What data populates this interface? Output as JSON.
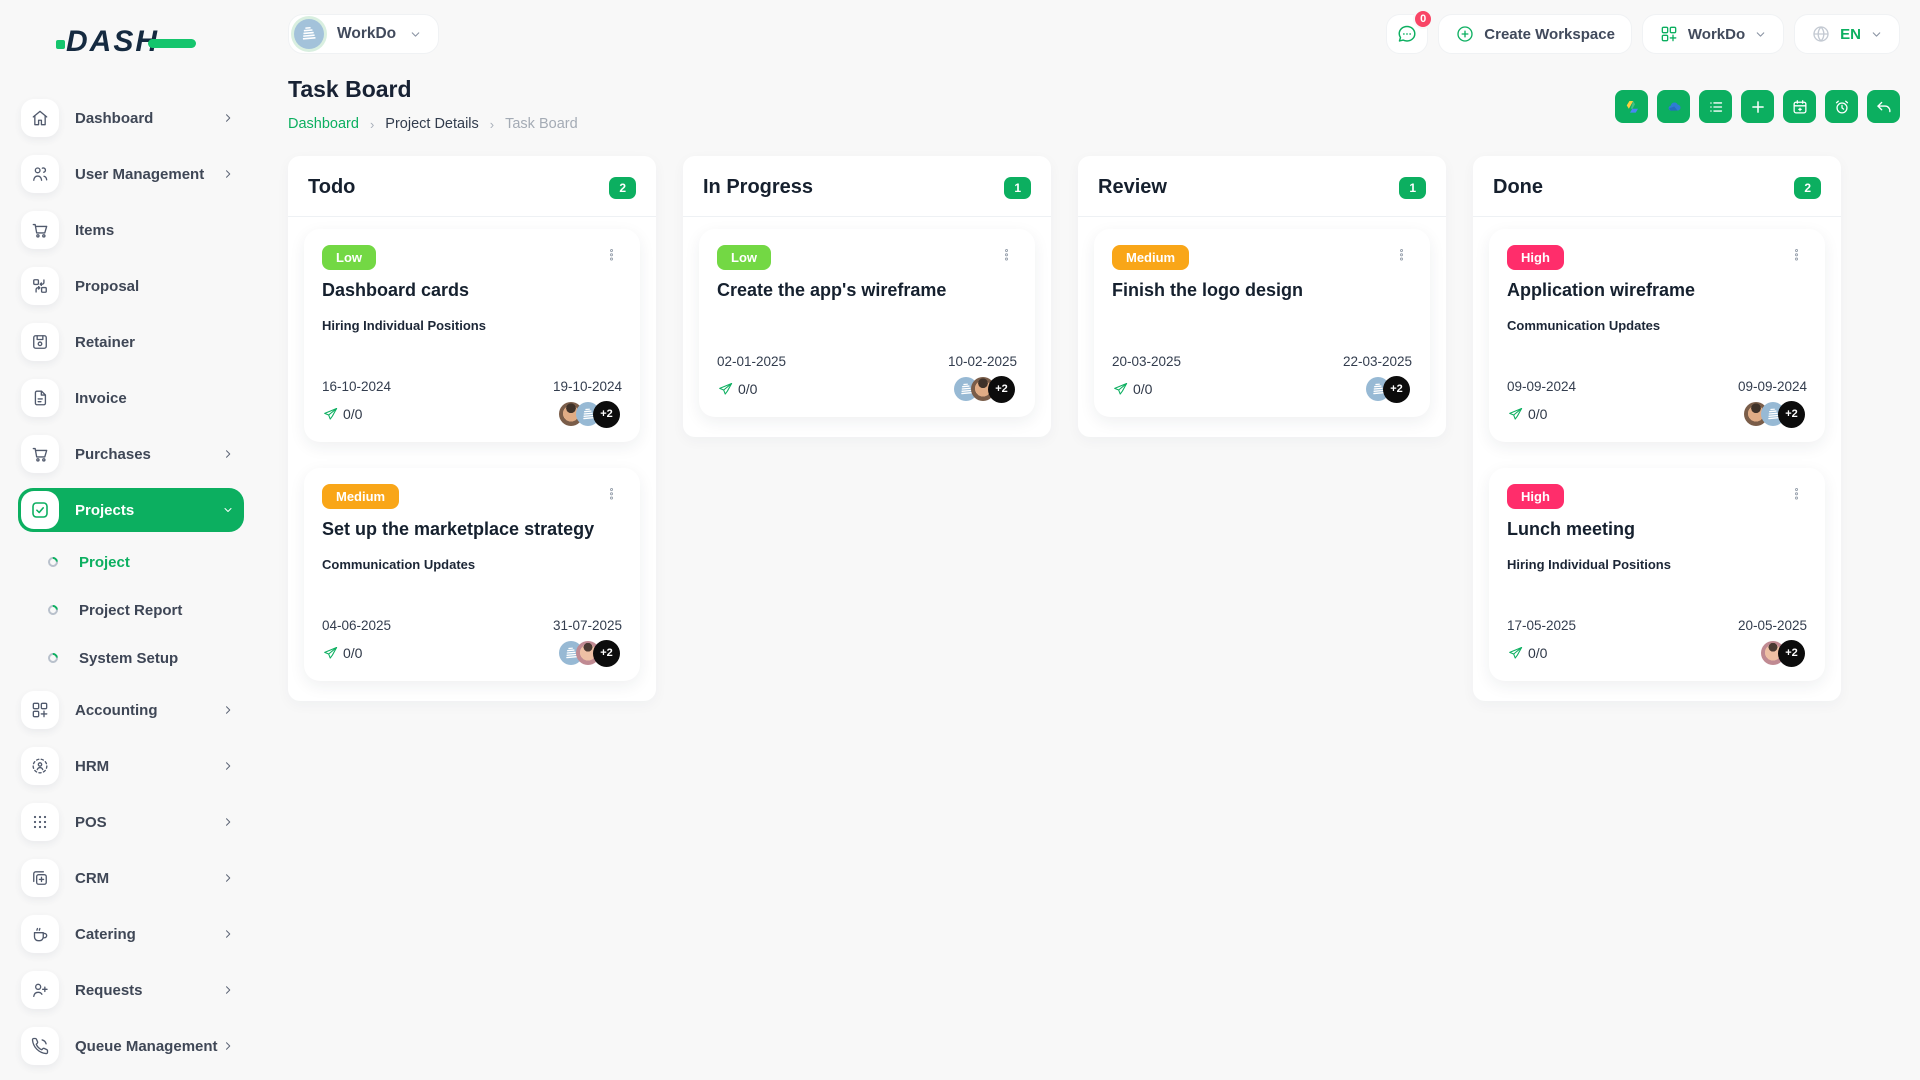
{
  "app": {
    "logo_text": "DASH"
  },
  "colors": {
    "primary": "#0CAF60",
    "priority_low": "#73d844",
    "priority_medium": "#f9a618",
    "priority_high": "#ff2d6b",
    "notification_badge": "#f94566",
    "workdo_avatar_bg": "#97b9d4"
  },
  "sidebar": {
    "items": [
      {
        "label": "Dashboard",
        "icon": "home",
        "chevron": "right"
      },
      {
        "label": "User Management",
        "icon": "users",
        "chevron": "right"
      },
      {
        "label": "Items",
        "icon": "cart",
        "chevron": ""
      },
      {
        "label": "Proposal",
        "icon": "proposal",
        "chevron": ""
      },
      {
        "label": "Retainer",
        "icon": "retainer",
        "chevron": ""
      },
      {
        "label": "Invoice",
        "icon": "invoice",
        "chevron": ""
      },
      {
        "label": "Purchases",
        "icon": "cart",
        "chevron": "right"
      },
      {
        "label": "Projects",
        "icon": "check-square",
        "chevron": "down",
        "active": true,
        "children": [
          {
            "label": "Project",
            "active": true
          },
          {
            "label": "Project Report",
            "active": false
          },
          {
            "label": "System Setup",
            "active": false
          }
        ]
      },
      {
        "label": "Accounting",
        "icon": "grid-plus",
        "chevron": "right"
      },
      {
        "label": "HRM",
        "icon": "hrm",
        "chevron": "right"
      },
      {
        "label": "POS",
        "icon": "dots-grid",
        "chevron": "right"
      },
      {
        "label": "CRM",
        "icon": "crm",
        "chevron": "right"
      },
      {
        "label": "Catering",
        "icon": "coffee",
        "chevron": "right"
      },
      {
        "label": "Requests",
        "icon": "user-plus",
        "chevron": "right"
      },
      {
        "label": "Queue Management",
        "icon": "phone",
        "chevron": "right"
      }
    ]
  },
  "header": {
    "workspace_name": "WorkDo",
    "messages_badge": "0",
    "create_workspace_label": "Create Workspace",
    "app_switcher_label": "WorkDo",
    "language": "EN"
  },
  "page": {
    "title": "Task Board",
    "breadcrumb": [
      {
        "label": "Dashboard"
      },
      {
        "label": "Project Details"
      },
      {
        "label": "Task Board"
      }
    ],
    "breadcrumb_separator": "›",
    "toolbar": [
      {
        "icon": "gdrive",
        "name": "google-drive"
      },
      {
        "icon": "onedrive",
        "name": "onedrive"
      },
      {
        "icon": "list",
        "name": "task-list"
      },
      {
        "icon": "plus",
        "name": "add-task"
      },
      {
        "icon": "calendar",
        "name": "calendar"
      },
      {
        "icon": "alarm",
        "name": "reminder"
      },
      {
        "icon": "undo",
        "name": "back"
      }
    ]
  },
  "board": {
    "columns": [
      {
        "title": "Todo",
        "count": "2",
        "cards": [
          {
            "priority": "Low",
            "title": "Dashboard cards",
            "milestone": "Hiring Individual Positions",
            "start": "16-10-2024",
            "end": "19-10-2024",
            "progress": "0/0",
            "avatars": [
              "photo-1",
              "workdo"
            ],
            "more": "+2"
          },
          {
            "priority": "Medium",
            "title": "Set up the marketplace strategy",
            "milestone": "Communication Updates",
            "start": "04-06-2025",
            "end": "31-07-2025",
            "progress": "0/0",
            "avatars": [
              "workdo",
              "photo-2"
            ],
            "more": "+2"
          }
        ]
      },
      {
        "title": "In Progress",
        "count": "1",
        "cards": [
          {
            "priority": "Low",
            "title": "Create the app's wireframe",
            "milestone": "",
            "start": "02-01-2025",
            "end": "10-02-2025",
            "progress": "0/0",
            "avatars": [
              "workdo",
              "photo-1"
            ],
            "more": "+2"
          }
        ]
      },
      {
        "title": "Review",
        "count": "1",
        "cards": [
          {
            "priority": "Medium",
            "title": "Finish the logo design",
            "milestone": "",
            "start": "20-03-2025",
            "end": "22-03-2025",
            "progress": "0/0",
            "avatars": [
              "workdo"
            ],
            "more": "+2"
          }
        ]
      },
      {
        "title": "Done",
        "count": "2",
        "cards": [
          {
            "priority": "High",
            "title": "Application wireframe",
            "milestone": "Communication Updates",
            "start": "09-09-2024",
            "end": "09-09-2024",
            "progress": "0/0",
            "avatars": [
              "photo-1",
              "workdo"
            ],
            "more": "+2"
          },
          {
            "priority": "High",
            "title": "Lunch meeting",
            "milestone": "Hiring Individual Positions",
            "start": "17-05-2025",
            "end": "20-05-2025",
            "progress": "0/0",
            "avatars": [
              "photo-2"
            ],
            "more": "+2"
          }
        ]
      }
    ]
  }
}
